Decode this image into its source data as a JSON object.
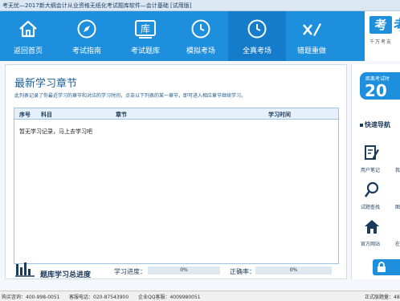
{
  "window": {
    "title": "考无忧—2017新大纲会计从业资格无纸化考试题库软件—会计基础 [试用版]"
  },
  "nav": {
    "items": [
      {
        "label": "返回首页",
        "icon": "home-icon"
      },
      {
        "label": "考试指南",
        "icon": "compass-icon"
      },
      {
        "label": "考试题库",
        "icon": "library-icon"
      },
      {
        "label": "模拟考场",
        "icon": "clock-icon"
      },
      {
        "label": "全真考场",
        "icon": "clock-icon"
      },
      {
        "label": "错题重做",
        "icon": "x-pencil-icon"
      }
    ],
    "active_index": 4
  },
  "brand": {
    "logo_box": "考",
    "logo_char": "考",
    "slogan": "千万考友"
  },
  "main": {
    "heading": "最新学习章节",
    "description": "此列表记录了你最近学习的章节和对应的学习时间，点击以下列表的某一章节，即可进入相应章节继续学习。",
    "table": {
      "col_seq": "序号",
      "col_subject": "科目",
      "col_chapter": "章节",
      "col_time": "学习时间",
      "empty_message": "暂无学习记录，马上去学习吧"
    },
    "progress": {
      "title": "题库学习总进度",
      "study_label": "学习进度：",
      "study_value": "0%",
      "study_fraction": 0,
      "accuracy_label": "正确率：",
      "accuracy_value": "0%",
      "accuracy_fraction": 0
    }
  },
  "right": {
    "countdown_label": "距离考试时",
    "countdown_value": "20",
    "quick_nav_title": "快速导航",
    "items": [
      {
        "label": "用户笔记",
        "partial": "我"
      },
      {
        "label": "试题查找",
        "partial": "图"
      },
      {
        "label": "官方网站",
        "partial": "在"
      }
    ]
  },
  "statusbar": {
    "hotline": "购买咨询：400-998-0051",
    "service_phone": "客服电话：020-87543900",
    "qq": "企业QQ客服：4009980051",
    "right_partial": "正式版题量：48"
  },
  "colors": {
    "nav_bg": "#1e8fdd",
    "nav_active": "#157ccb",
    "accent": "#1e8fdd"
  }
}
